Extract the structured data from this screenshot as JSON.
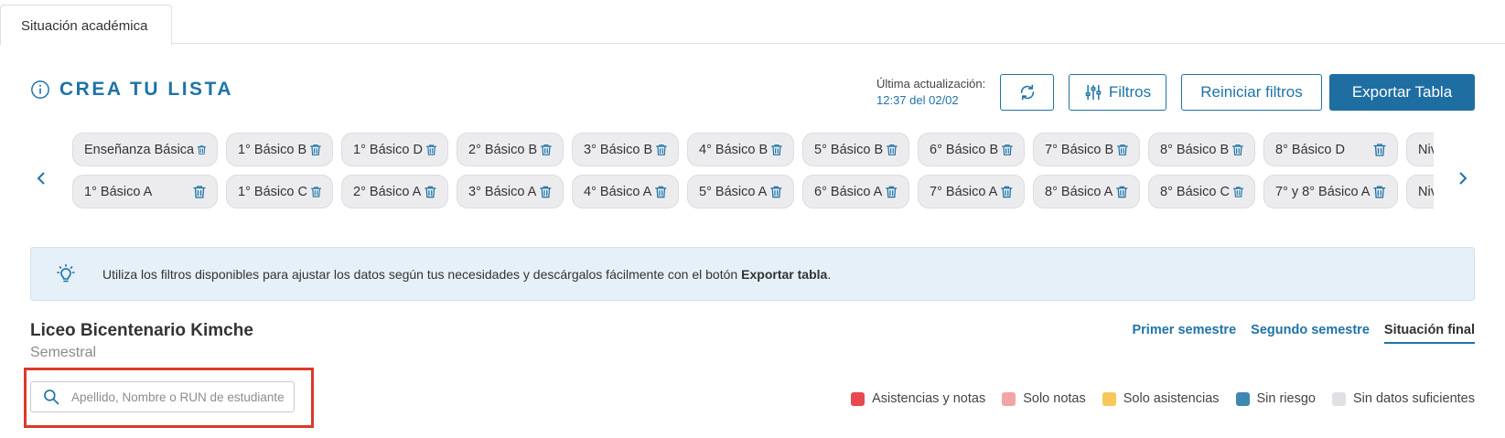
{
  "tab": {
    "label": "Situación académica"
  },
  "header": {
    "title": "CREA TU LISTA",
    "update_label": "Última actualización:",
    "update_time": "12:37 del 02/02",
    "filters_label": "Filtros",
    "reset_label": "Reiniciar filtros",
    "export_label": "Exportar Tabla"
  },
  "chips": {
    "row1": [
      "Enseñanza Básica",
      "1° Básico B",
      "1° Básico D",
      "2° Básico B",
      "3° Básico B",
      "4° Básico B",
      "5° Básico B",
      "6° Básico B",
      "7° Básico B",
      "8° Básico B",
      "8° Básico D",
      "Niv"
    ],
    "row2": [
      "1° Básico A",
      "1° Básico C",
      "2° Básico A",
      "3° Básico A",
      "4° Básico A",
      "5° Básico A",
      "6° Básico A",
      "7° Básico A",
      "8° Básico A",
      "8° Básico C",
      "7° y 8° Básico A",
      "Niv"
    ]
  },
  "tip": {
    "text": "Utiliza los filtros disponibles para ajustar los datos según tus necesidades y descárgalos fácilmente con el botón",
    "strong": "Exportar tabla",
    "end": "."
  },
  "school": {
    "name": "Liceo Bicentenario Kimche",
    "period": "Semestral"
  },
  "semester_tabs": [
    "Primer semestre",
    "Segundo semestre",
    "Situación final"
  ],
  "search": {
    "placeholder": "Apellido, Nombre o RUN de estudiante",
    "value": ""
  },
  "legend": [
    {
      "label": "Asistencias y notas",
      "color": "#e8484f"
    },
    {
      "label": "Solo notas",
      "color": "#f2a5a5"
    },
    {
      "label": "Solo asistencias",
      "color": "#f7c75c"
    },
    {
      "label": "Sin riesgo",
      "color": "#3f86b3"
    },
    {
      "label": "Sin datos suficientes",
      "color": "#dfe1e5"
    }
  ],
  "colors": {
    "accent": "#1f73a6",
    "highlight": "#d93a2b"
  }
}
